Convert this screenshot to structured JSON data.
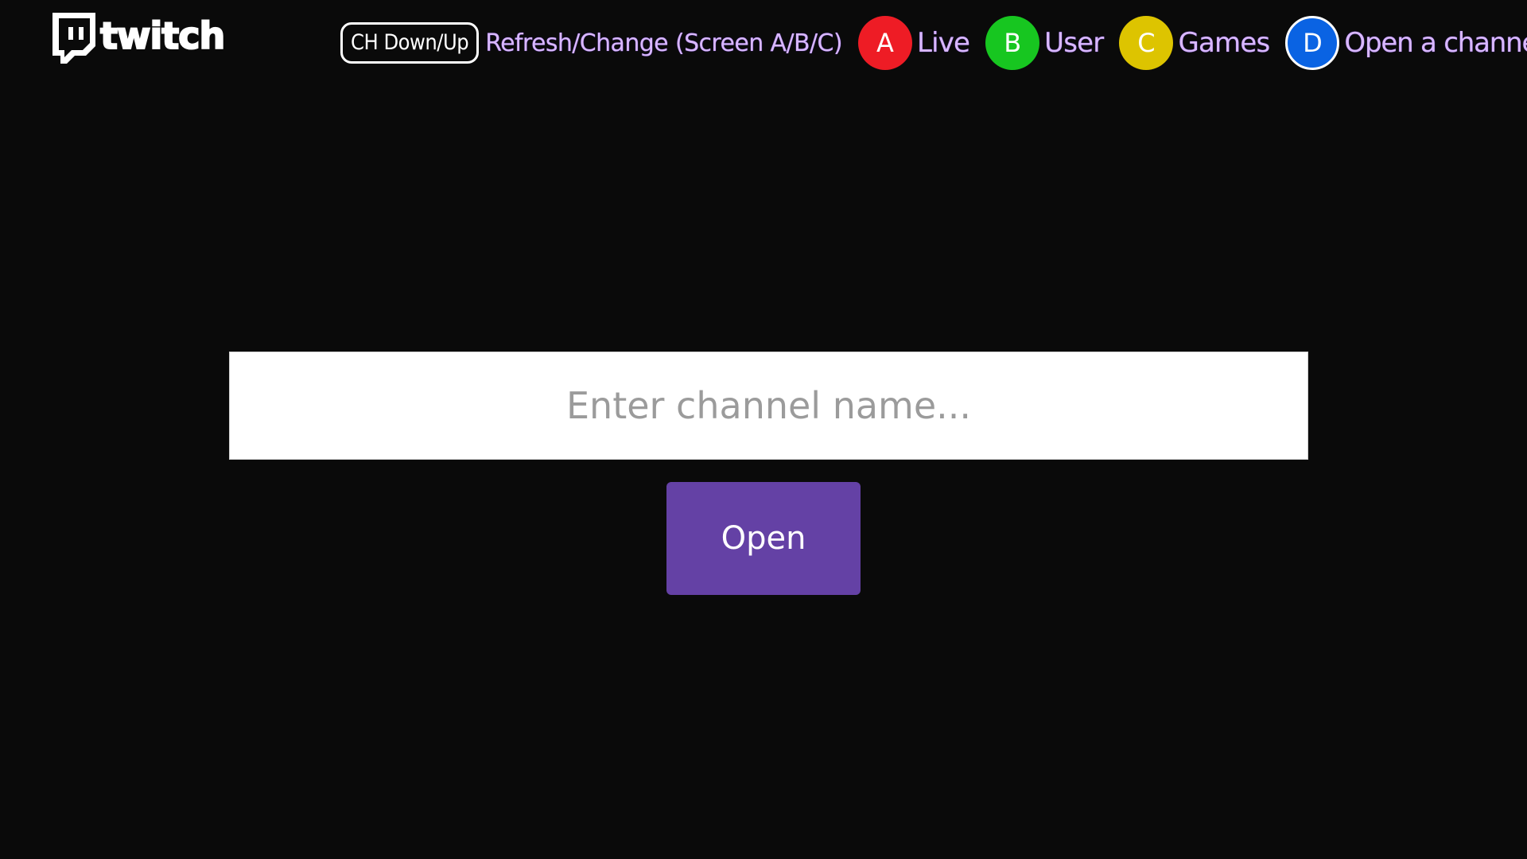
{
  "header": {
    "logo_text": "twitch",
    "ch_key_label": "CH Down/Up",
    "ch_key_hint": "Refresh/Change (Screen A/B/C)",
    "color_keys": [
      {
        "key": "A",
        "label": "Live",
        "color": "#ee1c25"
      },
      {
        "key": "B",
        "label": "User",
        "color": "#17c620"
      },
      {
        "key": "C",
        "label": "Games",
        "color": "#ddc400"
      },
      {
        "key": "D",
        "label": "Open a channel",
        "color": "#0a63e3"
      }
    ]
  },
  "channel": {
    "placeholder": "Enter channel name...",
    "value": "",
    "open_label": "Open"
  },
  "colors": {
    "background": "#0a0a0a",
    "accent": "#6441a5",
    "hint_text": "#d9b8ff"
  }
}
